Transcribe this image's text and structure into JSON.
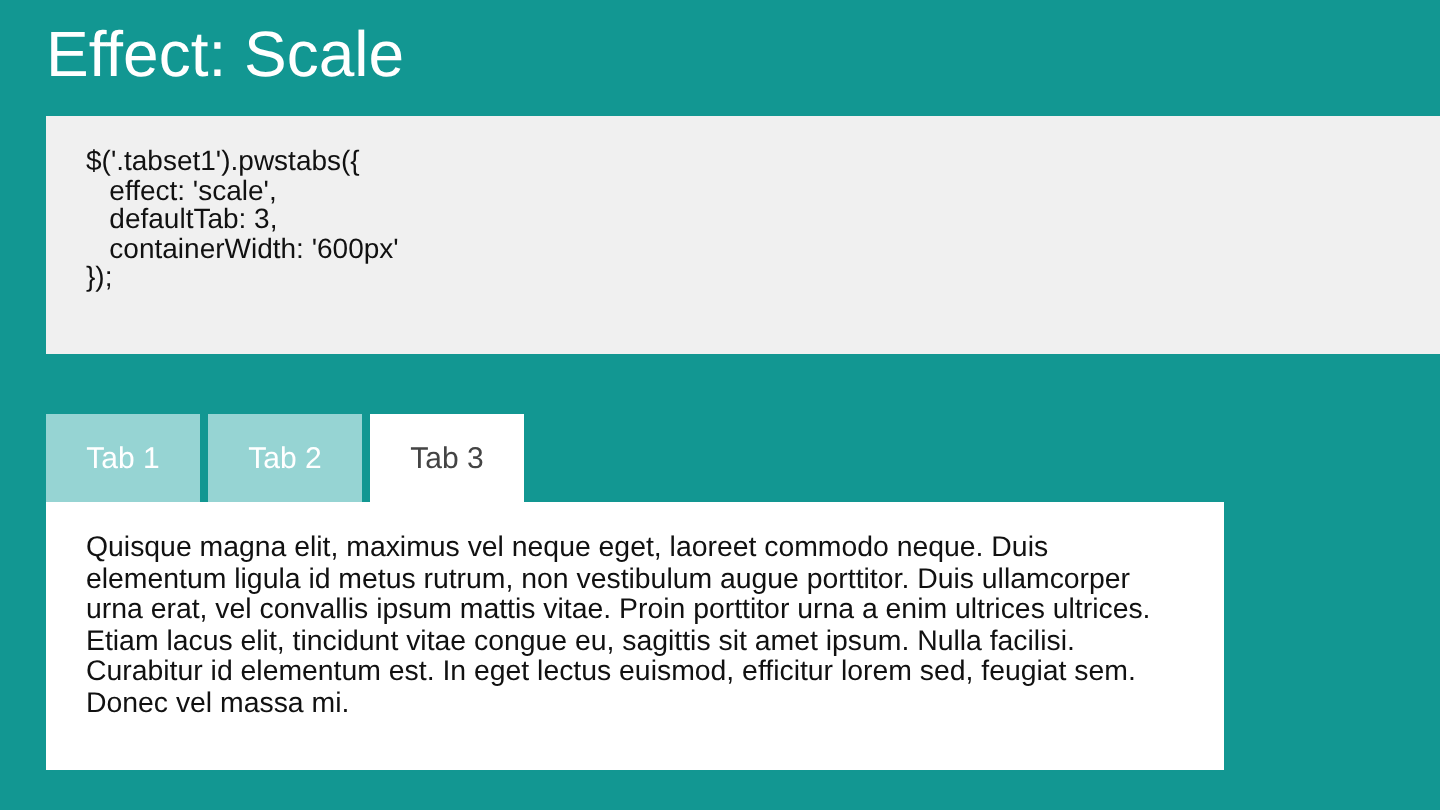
{
  "title": "Effect: Scale",
  "code": "$('.tabset1').pwstabs({\n   effect: 'scale',\n   defaultTab: 3,\n   containerWidth: '600px'\n});",
  "tabs": [
    {
      "label": "Tab 1",
      "selected": false
    },
    {
      "label": "Tab 2",
      "selected": false
    },
    {
      "label": "Tab 3",
      "selected": true
    }
  ],
  "content": "Quisque magna elit, maximus vel neque eget, laoreet commodo neque. Duis elementum ligula id metus rutrum, non vestibulum augue porttitor. Duis ullamcorper urna erat, vel convallis ipsum mattis vitae. Proin porttitor urna a enim ultrices ultrices. Etiam lacus elit, tincidunt vitae congue eu, sagittis sit amet ipsum. Nulla facilisi. Curabitur id elementum est. In eget lectus euismod, efficitur lorem sed, feugiat sem. Donec vel massa mi."
}
